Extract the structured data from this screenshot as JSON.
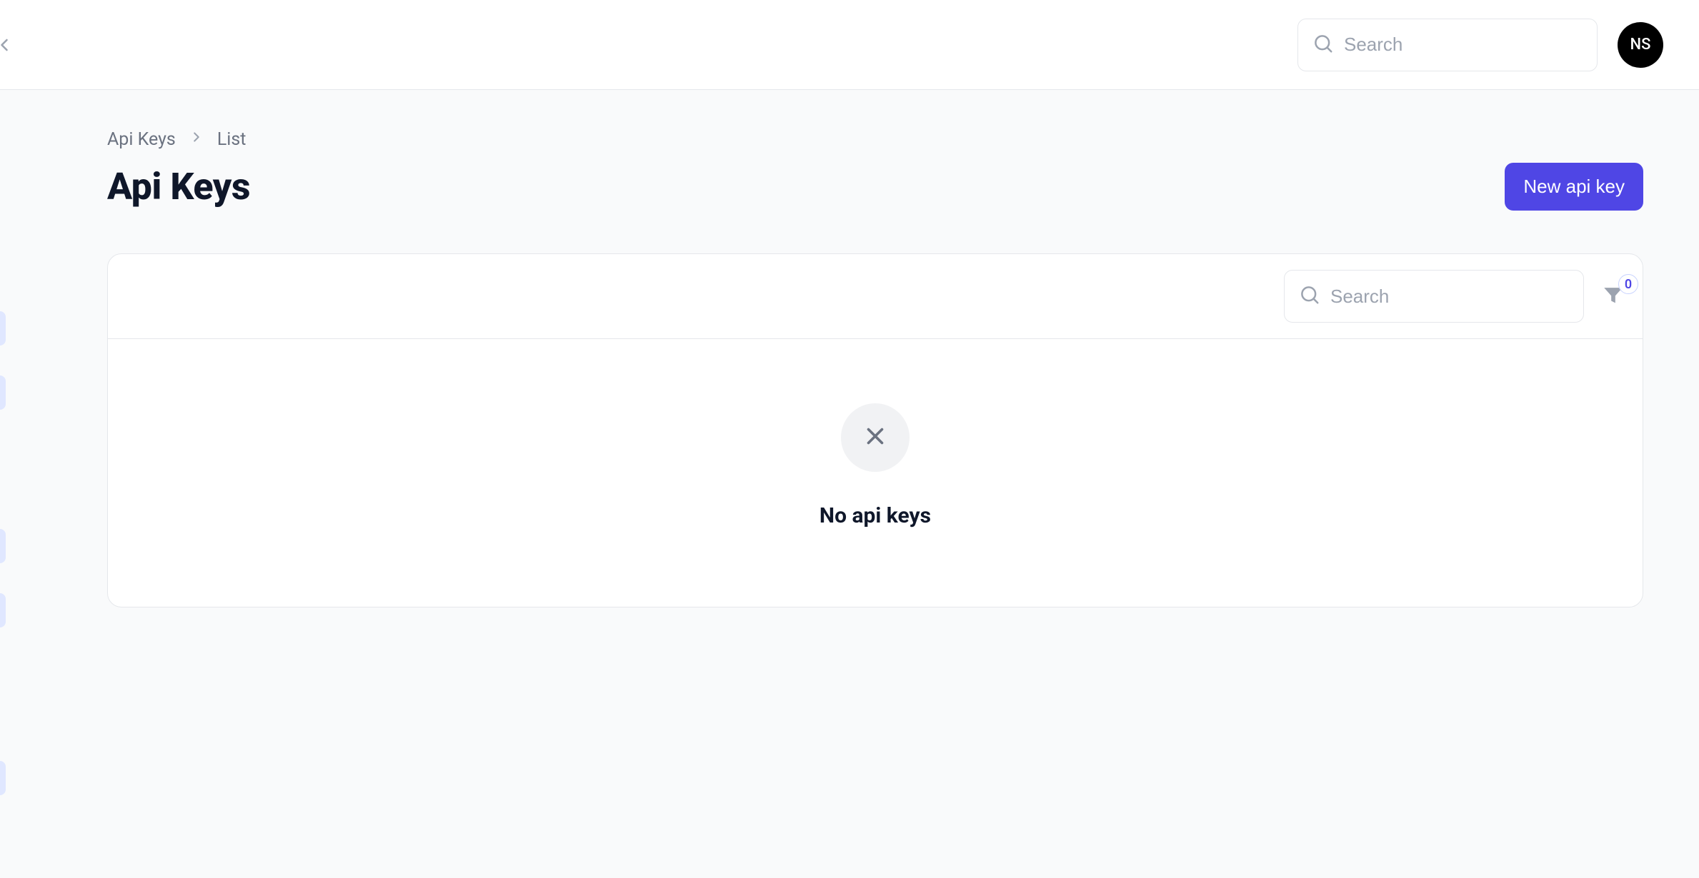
{
  "header": {
    "search_placeholder": "Search",
    "avatar_initials": "NS"
  },
  "breadcrumb": {
    "item1": "Api Keys",
    "item2": "List"
  },
  "page": {
    "title": "Api Keys",
    "new_button_label": "New api key"
  },
  "card": {
    "search_placeholder": "Search",
    "filter_count": "0",
    "empty_message": "No api keys"
  }
}
